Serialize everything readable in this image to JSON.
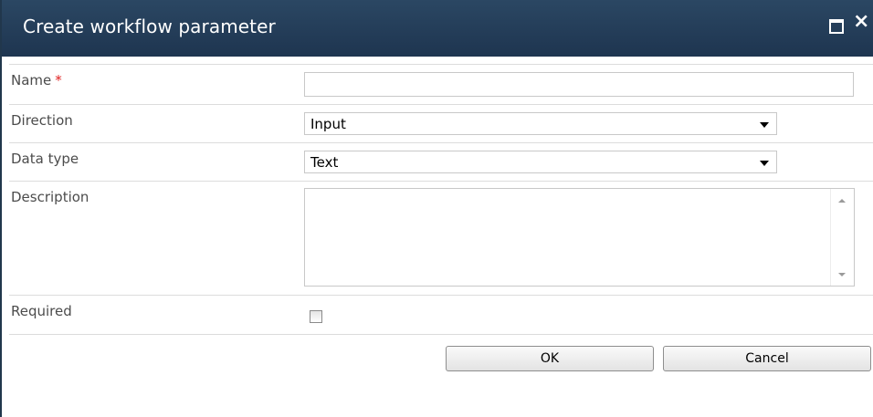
{
  "dialog": {
    "title": "Create workflow parameter",
    "maximize_icon": "maximize-icon",
    "close_icon": "close-icon",
    "close_glyph": "×"
  },
  "form": {
    "name": {
      "label": "Name",
      "required_marker": "*",
      "value": ""
    },
    "direction": {
      "label": "Direction",
      "selected": "Input"
    },
    "data_type": {
      "label": "Data type",
      "selected": "Text"
    },
    "description": {
      "label": "Description",
      "value": ""
    },
    "required": {
      "label": "Required",
      "checked": false
    }
  },
  "buttons": {
    "ok_label": "OK",
    "cancel_label": "Cancel"
  },
  "colors": {
    "titlebar": "#223a53",
    "required_star": "#e02020",
    "row_divider": "#dcdcdc"
  }
}
